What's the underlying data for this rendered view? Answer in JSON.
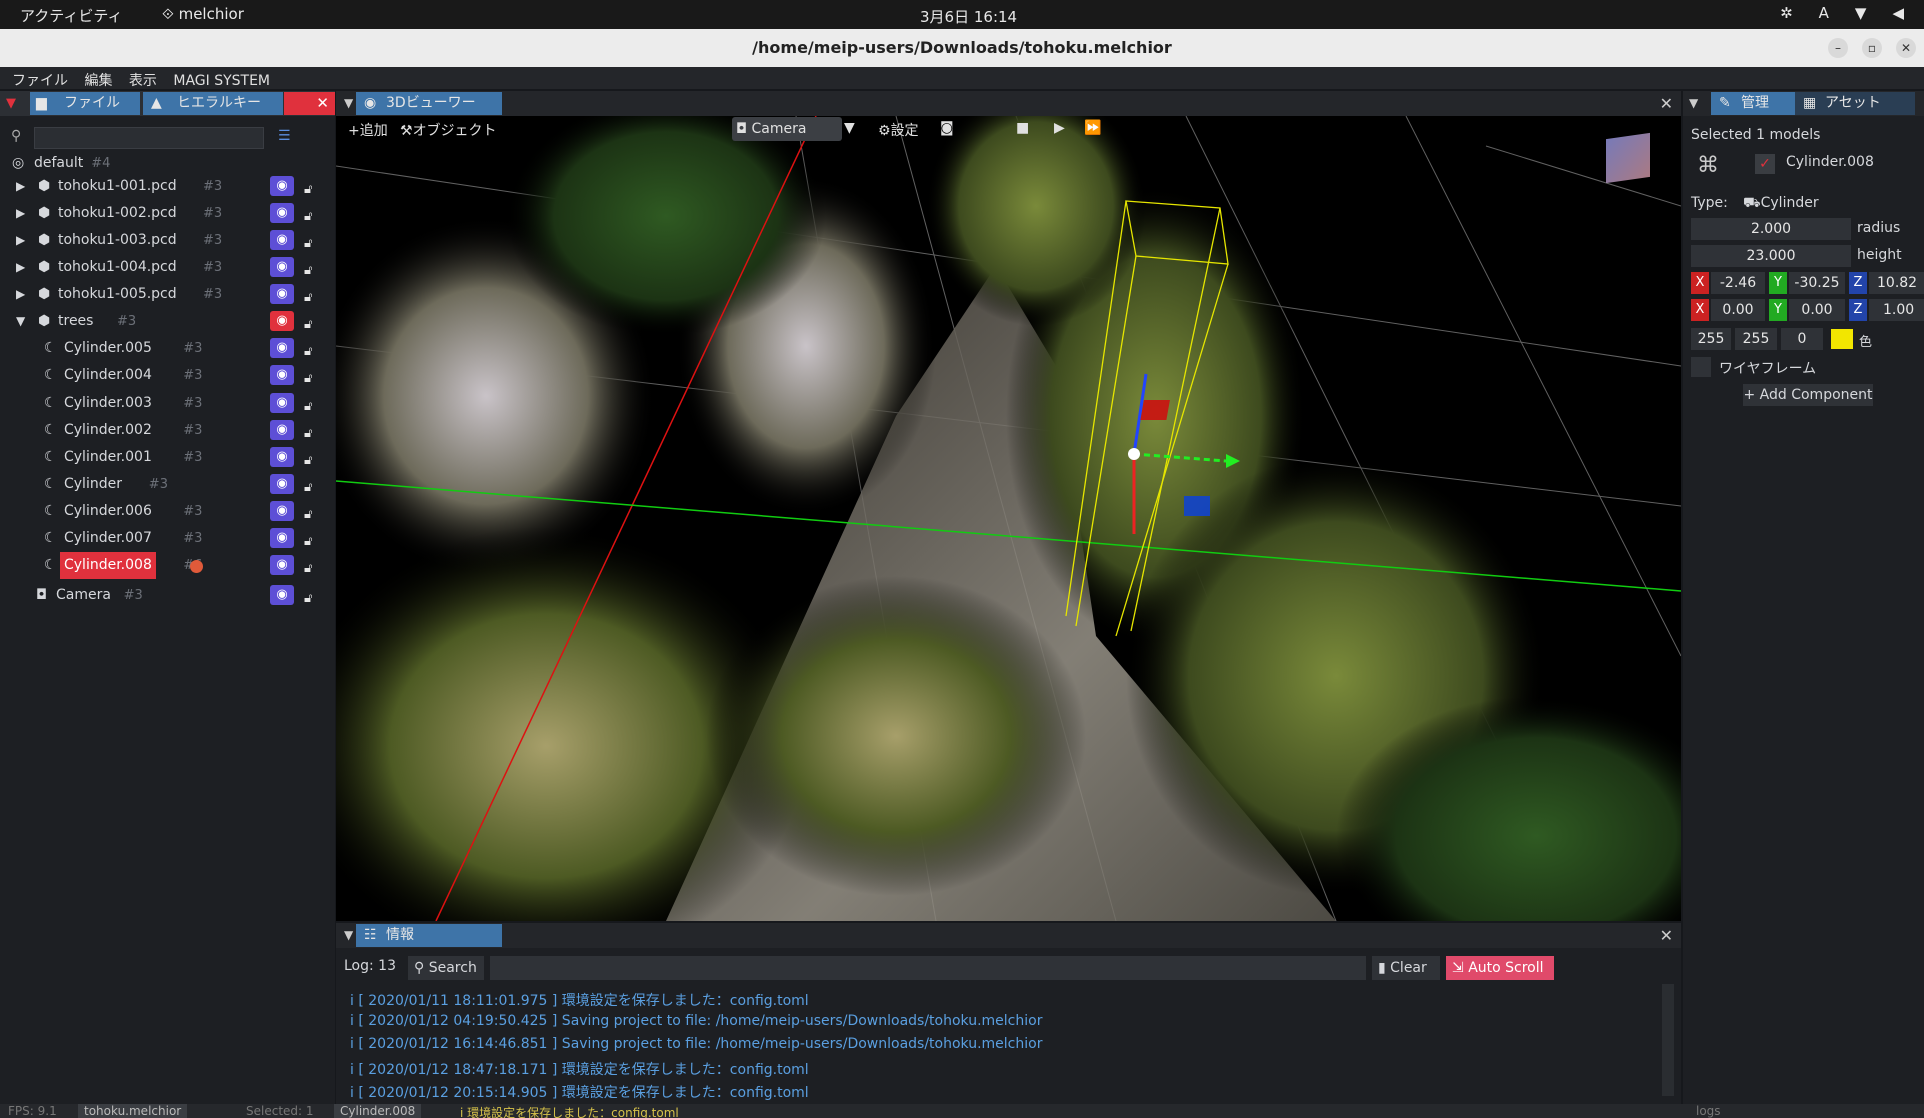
{
  "topbar": {
    "activities": "アクティビティ",
    "app_name": "melchior",
    "clock": "3月6日  16:14",
    "ime": "A"
  },
  "window": {
    "title": "/home/meip-users/Downloads/tohoku.melchior"
  },
  "menu": [
    "ファイル",
    "編集",
    "表示",
    "MAGI SYSTEM"
  ],
  "left": {
    "tabs": [
      "ファイル",
      "ヒエラルキー"
    ],
    "root": {
      "label": "default",
      "count": "#4"
    },
    "items": [
      {
        "label": "tohoku1-001.pcd",
        "count": "#3"
      },
      {
        "label": "tohoku1-002.pcd",
        "count": "#3"
      },
      {
        "label": "tohoku1-003.pcd",
        "count": "#3"
      },
      {
        "label": "tohoku1-004.pcd",
        "count": "#3"
      },
      {
        "label": "tohoku1-005.pcd",
        "count": "#3"
      },
      {
        "label": "trees",
        "count": "#3"
      },
      {
        "label": "Cylinder.005",
        "count": "#3"
      },
      {
        "label": "Cylinder.004",
        "count": "#3"
      },
      {
        "label": "Cylinder.003",
        "count": "#3"
      },
      {
        "label": "Cylinder.002",
        "count": "#3"
      },
      {
        "label": "Cylinder.001",
        "count": "#3"
      },
      {
        "label": "Cylinder",
        "count": "#3"
      },
      {
        "label": "Cylinder.006",
        "count": "#3"
      },
      {
        "label": "Cylinder.007",
        "count": "#3"
      },
      {
        "label": "Cylinder.008",
        "count": "#6"
      },
      {
        "label": "Camera",
        "count": "#3"
      }
    ]
  },
  "viewer": {
    "tab": "3Dビューワー",
    "toolbar": {
      "add": "+追加",
      "object": "オブジェクト",
      "camera": "Camera",
      "settings": "設定"
    }
  },
  "right": {
    "tabs": [
      "管理",
      "アセット"
    ],
    "selected": "Selected 1 models",
    "model_name": "Cylinder.008",
    "type_label": "Type:",
    "type_value": "Cylinder",
    "radius": {
      "value": "2.000",
      "label": "radius"
    },
    "height": {
      "value": "23.000",
      "label": "height"
    },
    "pos": {
      "x": "-2.46",
      "y": "-30.25",
      "z": "10.82"
    },
    "rot": {
      "x": "0.00",
      "y": "0.00",
      "z": "1.00"
    },
    "color": {
      "r": "255",
      "g": "255",
      "b": "0",
      "label": "色",
      "swatch": "#f2e600"
    },
    "wireframe": "ワイヤフレーム",
    "add_component": "+ Add Component",
    "axes": {
      "x": "X",
      "y": "Y",
      "z": "Z"
    }
  },
  "info": {
    "tab": "情報",
    "log_count": "Log: 13",
    "search": "Search",
    "clear": "Clear",
    "autoscroll": "Auto Scroll",
    "lines": [
      "[ 2020/01/11 18:11:01.975 ]   環境設定を保存しました：config.toml",
      "[ 2020/01/12 04:19:50.425 ]   Saving project to file: /home/meip-users/Downloads/tohoku.melchior",
      "[ 2020/01/12 16:14:46.851 ]   Saving project to file: /home/meip-users/Downloads/tohoku.melchior",
      "[ 2020/01/12 18:47:18.171 ]   環境設定を保存しました：config.toml",
      "[ 2020/01/12 20:15:14.905 ]   環境設定を保存しました：config.toml"
    ]
  },
  "status": {
    "fps": "FPS: 9.1",
    "file": "tohoku.melchior",
    "selected": "Selected: 1",
    "model": "Cylinder.008",
    "msg": "i  環境設定を保存しました：config.toml",
    "logs": "logs"
  }
}
